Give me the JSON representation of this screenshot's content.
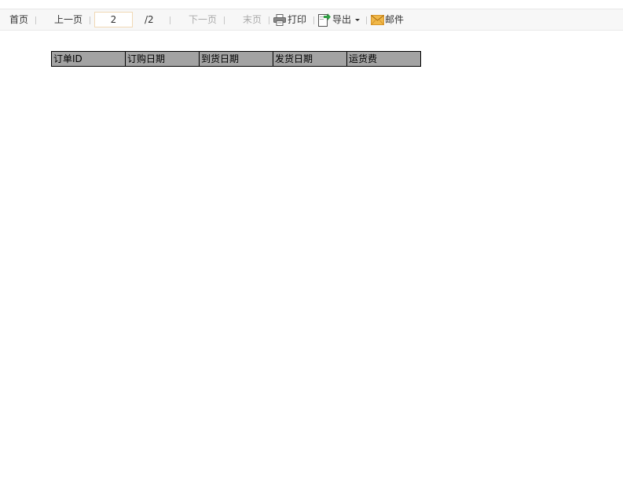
{
  "toolbar": {
    "first_label": "首页",
    "prev_label": "上一页",
    "current_page": "2",
    "total_pages": "/2",
    "next_label": "下一页",
    "last_label": "末页",
    "print_label": "打印",
    "export_label": "导出",
    "mail_label": "邮件",
    "icons": {
      "print": "printer-icon",
      "export": "export-icon",
      "export_menu": "caret-down-icon",
      "mail": "mail-icon"
    }
  },
  "table": {
    "columns": [
      "订单ID",
      "订购日期",
      "到货日期",
      "发货日期",
      "运货费"
    ],
    "header_bg": "#a3a3a3"
  }
}
